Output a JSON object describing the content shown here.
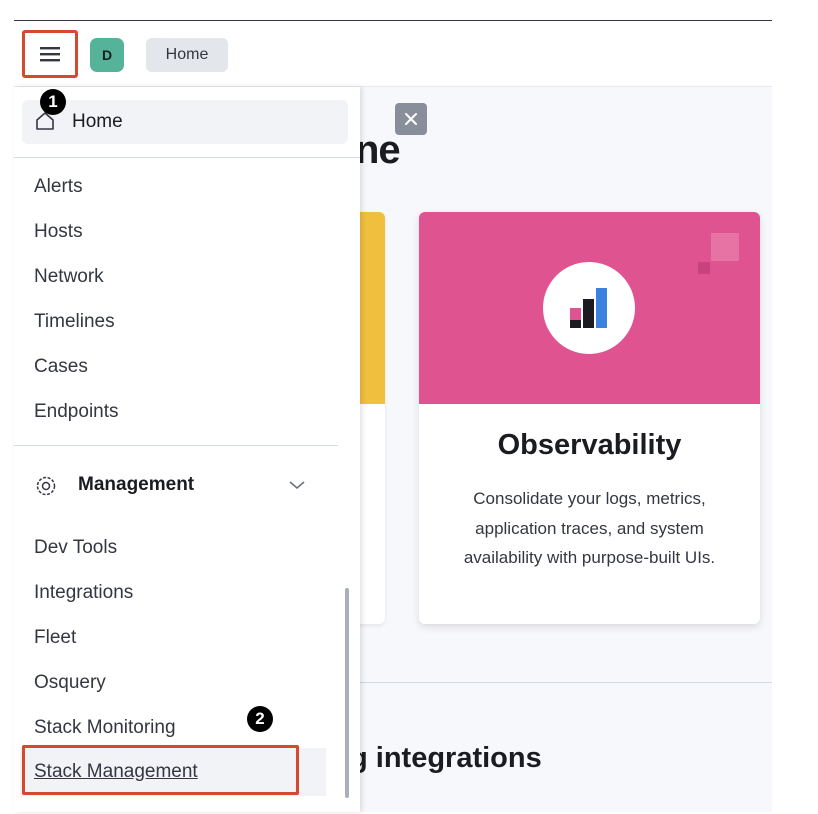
{
  "header": {
    "avatar_letter": "D",
    "breadcrumb": "Home"
  },
  "main": {
    "page_title_fragment": "ne",
    "card": {
      "title": "Observability",
      "description": "Consolidate your logs, metrics, application traces, and system availability with purpose-built UIs."
    },
    "section_title_fragment": "g integrations"
  },
  "nav": {
    "home_label": "Home",
    "items": [
      "Alerts",
      "Hosts",
      "Network",
      "Timelines",
      "Cases",
      "Endpoints"
    ],
    "management_label": "Management",
    "management_items": [
      "Dev Tools",
      "Integrations",
      "Fleet",
      "Osquery",
      "Stack Monitoring"
    ],
    "selected_item": "Stack Management"
  },
  "markers": {
    "step1": "1",
    "step2": "2"
  },
  "colors": {
    "highlight_border": "#d6492f",
    "avatar": "#54b399",
    "card_band": "#e05391",
    "partial_card_band": "#f0bf3d"
  }
}
